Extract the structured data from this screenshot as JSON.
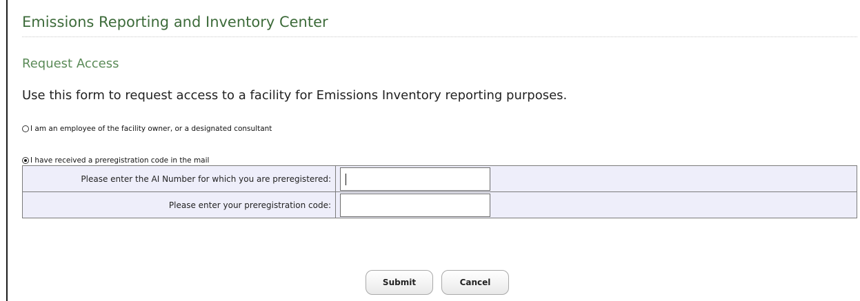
{
  "app": {
    "title": "Emissions Reporting and Inventory Center"
  },
  "page": {
    "section_title": "Request Access",
    "intro": "Use this form to request access to a facility for Emissions Inventory reporting purposes."
  },
  "options": {
    "employee": {
      "label": "I am an employee of the facility owner, or a designated consultant",
      "selected": false
    },
    "prereg": {
      "label": "I have received a preregistration code in the mail",
      "selected": true
    }
  },
  "form": {
    "ai_number": {
      "label": "Please enter the AI Number for which you are preregistered:",
      "value": ""
    },
    "prereg_code": {
      "label": "Please enter your preregistration code:",
      "value": ""
    }
  },
  "buttons": {
    "submit": "Submit",
    "cancel": "Cancel"
  },
  "colors": {
    "title_green": "#3d6b3a",
    "subtitle_green": "#5a8a57",
    "table_bg": "#eeeefa"
  }
}
